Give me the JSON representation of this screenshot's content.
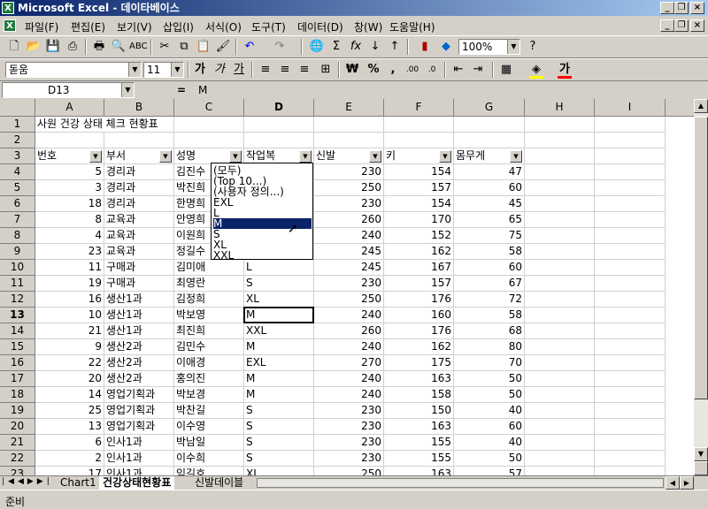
{
  "window": {
    "title": "Microsoft Excel - 데이타베이스",
    "app_icon": "excel-icon",
    "controls": {
      "minimize": "_",
      "restore": "❐",
      "close": "×"
    }
  },
  "menu": [
    "파일(F)",
    "편집(E)",
    "보기(V)",
    "삽입(I)",
    "서식(O)",
    "도구(T)",
    "데이터(D)",
    "창(W)",
    "도움말(H)"
  ],
  "toolbar": {
    "zoom": "100%",
    "icons": [
      "new-icon",
      "open-icon",
      "save-icon",
      "permission-icon",
      "print-icon",
      "print-preview-icon",
      "spelling-icon",
      "cut-icon",
      "copy-icon",
      "paste-icon",
      "format-painter-icon",
      "undo-icon",
      "redo-icon",
      "hyperlink-icon",
      "autosum-icon",
      "function-icon",
      "sort-ascending-icon",
      "sort-descending-icon",
      "chart-wizard-icon",
      "drawing-icon",
      "help-icon"
    ]
  },
  "formatting": {
    "font": "돋움",
    "size": "11",
    "bold": "가",
    "italic": "가",
    "underline": "가",
    "currency": "₩",
    "percent": "%",
    "comma": ",",
    "font_color_label": "가",
    "accent_fill": "#ffff00",
    "accent_font": "#ff0000"
  },
  "formula_bar": {
    "name_box": "D13",
    "equals": "=",
    "content": "M"
  },
  "columns": [
    "A",
    "B",
    "C",
    "D",
    "E",
    "F",
    "G",
    "H",
    "I"
  ],
  "active_column": "D",
  "active_row": "13",
  "sheet": {
    "title": "사원 건강 상태 체크 현황표",
    "headers": [
      "번호",
      "부서",
      "성명",
      "작업복",
      "신발",
      "키",
      "몸무게"
    ],
    "rows": [
      {
        "r": "4",
        "no": "5",
        "dept": "경리과",
        "name": "김진수",
        "size": "",
        "shoe": "230",
        "height": "154",
        "weight": "47"
      },
      {
        "r": "5",
        "no": "3",
        "dept": "경리과",
        "name": "박진희",
        "size": "",
        "shoe": "250",
        "height": "157",
        "weight": "60"
      },
      {
        "r": "6",
        "no": "18",
        "dept": "경리과",
        "name": "한명희",
        "size": "",
        "shoe": "230",
        "height": "154",
        "weight": "45"
      },
      {
        "r": "7",
        "no": "8",
        "dept": "교육과",
        "name": "안영희",
        "size": "",
        "shoe": "260",
        "height": "170",
        "weight": "65"
      },
      {
        "r": "8",
        "no": "4",
        "dept": "교육과",
        "name": "이원희",
        "size": "",
        "shoe": "240",
        "height": "152",
        "weight": "75"
      },
      {
        "r": "9",
        "no": "23",
        "dept": "교육과",
        "name": "정길수",
        "size": "",
        "shoe": "245",
        "height": "162",
        "weight": "58"
      },
      {
        "r": "10",
        "no": "11",
        "dept": "구매과",
        "name": "김미애",
        "size": "L",
        "shoe": "245",
        "height": "167",
        "weight": "60"
      },
      {
        "r": "11",
        "no": "19",
        "dept": "구매과",
        "name": "최영란",
        "size": "S",
        "shoe": "230",
        "height": "157",
        "weight": "67"
      },
      {
        "r": "12",
        "no": "16",
        "dept": "생산1과",
        "name": "김정희",
        "size": "XL",
        "shoe": "250",
        "height": "176",
        "weight": "72"
      },
      {
        "r": "13",
        "no": "10",
        "dept": "생산1과",
        "name": "박보영",
        "size": "M",
        "shoe": "240",
        "height": "160",
        "weight": "58"
      },
      {
        "r": "14",
        "no": "21",
        "dept": "생산1과",
        "name": "최진희",
        "size": "XXL",
        "shoe": "260",
        "height": "176",
        "weight": "68"
      },
      {
        "r": "15",
        "no": "9",
        "dept": "생산2과",
        "name": "김민수",
        "size": "M",
        "shoe": "240",
        "height": "162",
        "weight": "80"
      },
      {
        "r": "16",
        "no": "22",
        "dept": "생산2과",
        "name": "이애경",
        "size": "EXL",
        "shoe": "270",
        "height": "175",
        "weight": "70"
      },
      {
        "r": "17",
        "no": "20",
        "dept": "생산2과",
        "name": "홍의진",
        "size": "M",
        "shoe": "240",
        "height": "163",
        "weight": "50"
      },
      {
        "r": "18",
        "no": "14",
        "dept": "영업기획과",
        "name": "박보경",
        "size": "M",
        "shoe": "240",
        "height": "158",
        "weight": "50"
      },
      {
        "r": "19",
        "no": "25",
        "dept": "영업기획과",
        "name": "박찬길",
        "size": "S",
        "shoe": "230",
        "height": "150",
        "weight": "40"
      },
      {
        "r": "20",
        "no": "13",
        "dept": "영업기획과",
        "name": "이수영",
        "size": "S",
        "shoe": "230",
        "height": "163",
        "weight": "60"
      },
      {
        "r": "21",
        "no": "6",
        "dept": "인사1과",
        "name": "박남일",
        "size": "S",
        "shoe": "230",
        "height": "155",
        "weight": "40"
      },
      {
        "r": "22",
        "no": "2",
        "dept": "인사1과",
        "name": "이수희",
        "size": "S",
        "shoe": "230",
        "height": "155",
        "weight": "50"
      },
      {
        "r": "23",
        "no": "17",
        "dept": "인사1과",
        "name": "임길호",
        "size": "XL",
        "shoe": "250",
        "height": "163",
        "weight": "57"
      }
    ]
  },
  "autofilter_dropdown": {
    "items": [
      "(모두)",
      "(Top 10...)",
      "(사용자 정의...)",
      "EXL",
      "L",
      "M",
      "S",
      "XL",
      "XXL"
    ],
    "selected": "M"
  },
  "sheet_tabs": [
    "Chart1",
    "건강상태현황표",
    "신발데이블"
  ],
  "active_tab": "건강상태현황표",
  "status": "준비"
}
